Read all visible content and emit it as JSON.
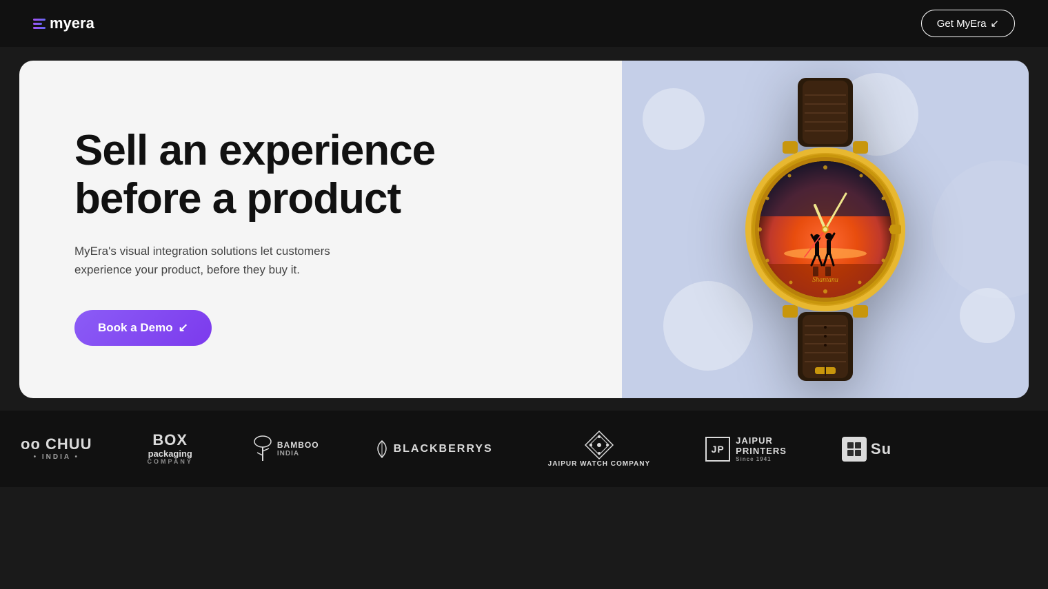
{
  "navbar": {
    "logo_text": "myera",
    "cta_label": "Get MyEra",
    "cta_arrow": "↙"
  },
  "hero": {
    "title_line1": "Sell an experience",
    "title_line2": "before a product",
    "subtitle": "MyEra's visual integration solutions let customers experience your product, before they buy it.",
    "book_demo_label": "Book a Demo",
    "book_demo_arrow": "↙"
  },
  "brands": [
    {
      "id": "oochuu",
      "display": "oo CHUU",
      "sub": "• INDIA •"
    },
    {
      "id": "box-packaging",
      "display": "BOX packaging",
      "sub": "COMPANY"
    },
    {
      "id": "bamboo-india",
      "display": "BAMBOO INDIA",
      "sub": ""
    },
    {
      "id": "blackberrys",
      "display": "BLACKBERRYS",
      "sub": ""
    },
    {
      "id": "jaipur-watch",
      "display": "JAIPUR WATCH COMPANY",
      "sub": ""
    },
    {
      "id": "jaipur-printers",
      "display": "JAIPUR PRINTERS",
      "sub": "Since 1941"
    }
  ],
  "colors": {
    "navbar_bg": "#111111",
    "hero_bg": "#f5f5f5",
    "hero_right_bg": "#c5cfe8",
    "cta_gradient_start": "#8b5cf6",
    "cta_gradient_end": "#7c3aed",
    "brands_bg": "#111111"
  }
}
